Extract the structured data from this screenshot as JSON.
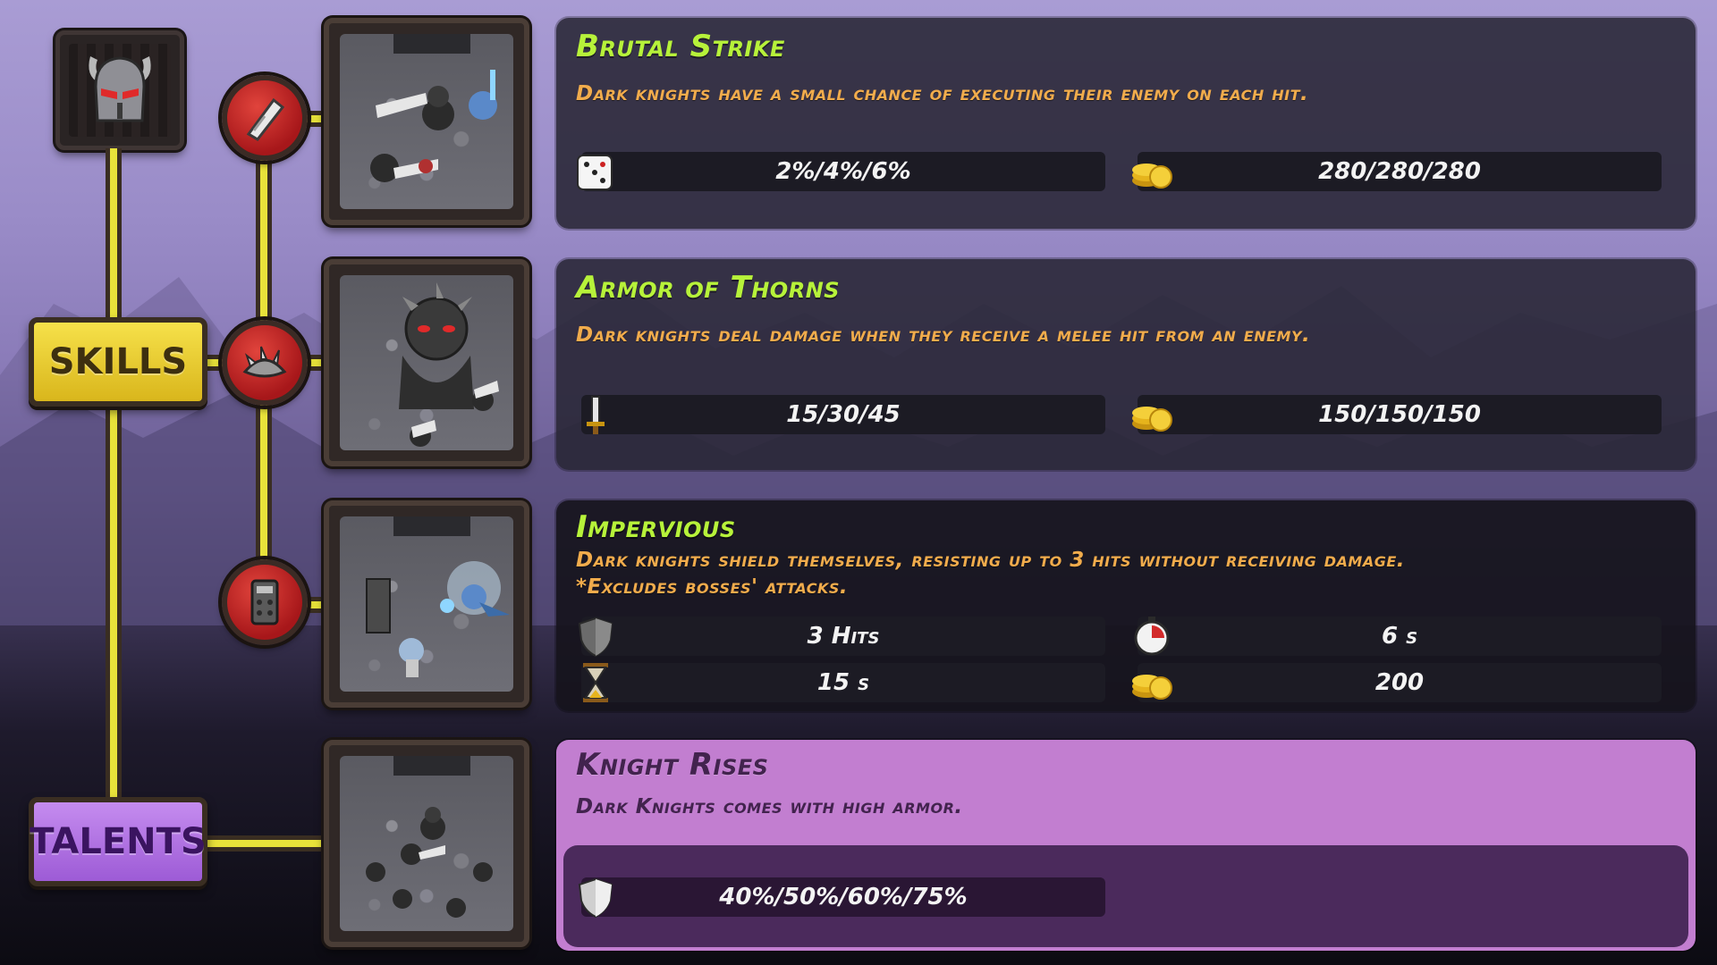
{
  "tabs": {
    "skills": "SKILLS",
    "talents": "TALENTS"
  },
  "skills": [
    {
      "title": "Brutal Strike",
      "description": "Dark knights have a small chance of executing their enemy on each hit.",
      "stats": [
        {
          "icon": "dice-icon",
          "value": "2%/4%/6%"
        },
        {
          "icon": "gold-coins-icon",
          "value": "280/280/280"
        }
      ]
    },
    {
      "title": "Armor of Thorns",
      "description": "Dark knights deal damage when they receive a melee hit from an enemy.",
      "stats": [
        {
          "icon": "sword-icon",
          "value": "15/30/45"
        },
        {
          "icon": "gold-coins-icon",
          "value": "150/150/150"
        }
      ]
    },
    {
      "title": "Impervious",
      "description": "Dark knights shield themselves, resisting up to 3 hits without receiving damage.",
      "note": "*Excludes bosses' attacks.",
      "stats": [
        {
          "icon": "shield-icon",
          "value": "3 Hits"
        },
        {
          "icon": "stopwatch-icon",
          "value": "6 s"
        },
        {
          "icon": "hourglass-icon",
          "value": "15 s"
        },
        {
          "icon": "gold-coins-icon",
          "value": "200"
        }
      ]
    }
  ],
  "talent": {
    "title": "Knight Rises",
    "description": "Dark Knights comes with high armor.",
    "stats": [
      {
        "icon": "armor-shield-icon",
        "value": "40%/50%/60%/75%"
      }
    ]
  },
  "colors": {
    "title_green": "#b7f23a",
    "desc_orange": "#f1ac4c",
    "skills_yellow": "#f6e14a",
    "talents_purple": "#c58cef",
    "talent_panel": "#c27ed0",
    "skill_red": "#c4211f"
  }
}
